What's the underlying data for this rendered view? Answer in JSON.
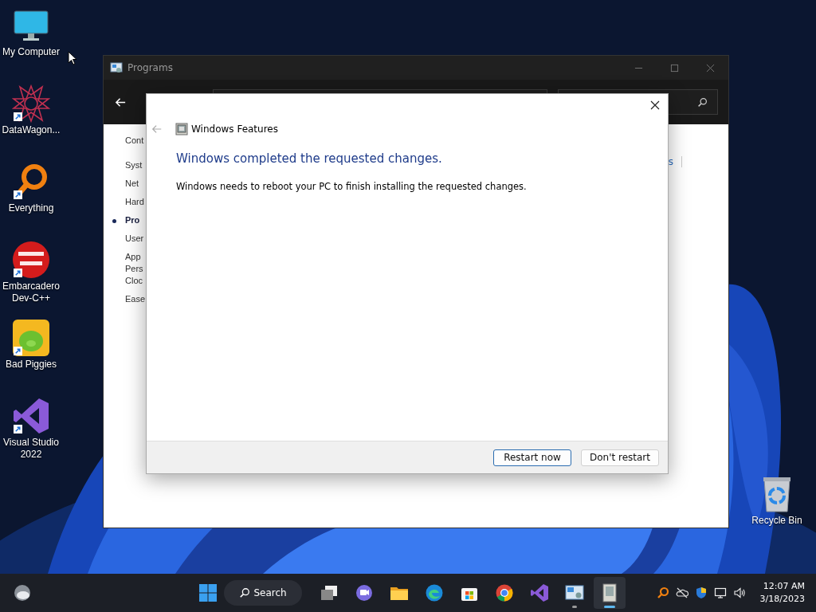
{
  "desktop_icons": [
    {
      "label": "My Computer",
      "kind": "computer",
      "shortcut": false
    },
    {
      "label": "DataWagon...",
      "kind": "star",
      "shortcut": true
    },
    {
      "label": "Everything",
      "kind": "magnifier",
      "shortcut": true
    },
    {
      "label": "Embarcadero Dev-C++",
      "kind": "devcpp",
      "shortcut": true
    },
    {
      "label": "Bad Piggies",
      "kind": "pig",
      "shortcut": true
    },
    {
      "label": "Visual Studio 2022",
      "kind": "vs",
      "shortcut": true
    }
  ],
  "recycle_bin": {
    "label": "Recycle Bin"
  },
  "programs_window": {
    "title": "Programs",
    "sidebar": {
      "items": [
        {
          "label": "Syst",
          "selected": false
        },
        {
          "label": "Net",
          "selected": false
        },
        {
          "label": "Hard",
          "selected": false
        },
        {
          "label": "Pro",
          "selected": true
        },
        {
          "label": "User",
          "selected": false
        },
        {
          "label": "App\nPers",
          "selected": false
        },
        {
          "label": "Cloc",
          "selected": false
        },
        {
          "label": "Ease",
          "selected": false
        }
      ],
      "heading": "Cont"
    },
    "right_link": "s"
  },
  "dialog": {
    "title": "Windows Features",
    "heading": "Windows completed the requested changes.",
    "message": "Windows needs to reboot your PC to finish installing the requested changes.",
    "buttons": [
      {
        "label": "Restart now",
        "default": true
      },
      {
        "label": "Don't restart",
        "default": false
      }
    ]
  },
  "taskbar": {
    "search": "Search",
    "apps": [
      {
        "kind": "taskview",
        "running": false,
        "active": false
      },
      {
        "kind": "chat",
        "running": false,
        "active": false
      },
      {
        "kind": "folder",
        "running": false,
        "active": false
      },
      {
        "kind": "edge",
        "running": false,
        "active": false
      },
      {
        "kind": "store",
        "running": false,
        "active": false
      },
      {
        "kind": "chrome",
        "running": false,
        "active": false
      },
      {
        "kind": "vs",
        "running": false,
        "active": false
      },
      {
        "kind": "control",
        "running": true,
        "active": false
      },
      {
        "kind": "features",
        "running": true,
        "active": true
      }
    ],
    "tray": [
      {
        "kind": "search"
      },
      {
        "kind": "cloud"
      },
      {
        "kind": "shield"
      },
      {
        "kind": "network"
      },
      {
        "kind": "volume"
      }
    ],
    "time": "12:07 AM",
    "date": "3/18/2023"
  }
}
